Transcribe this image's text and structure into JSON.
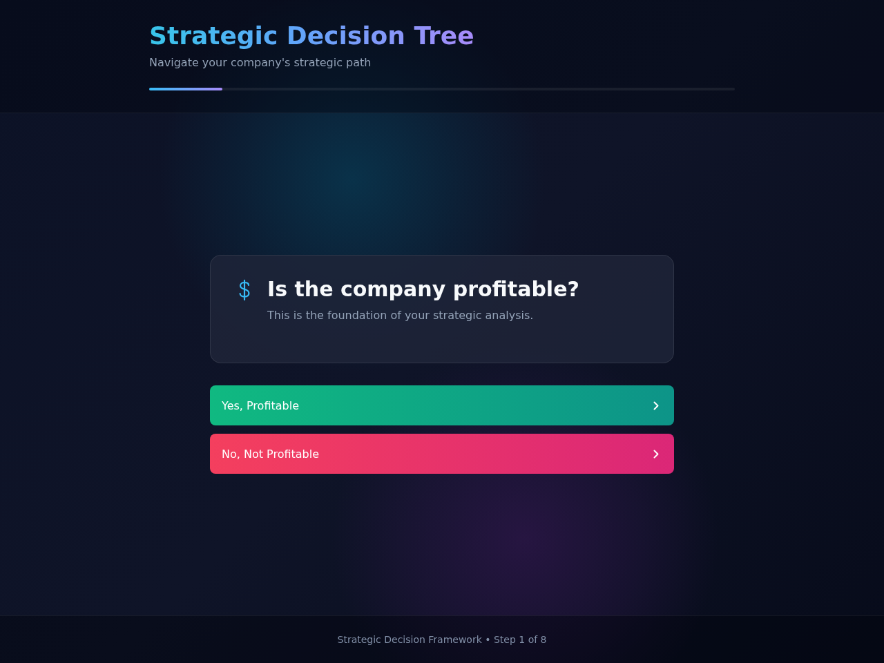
{
  "header": {
    "title": "Strategic Decision Tree",
    "subtitle": "Navigate your company's strategic path",
    "progress": {
      "level": 0.125
    }
  },
  "question": {
    "title": "Is the company profitable?",
    "description": "This is the foundation of your strategic analysis."
  },
  "options": [
    {
      "label": "Yes, Profitable",
      "kind": "positive"
    },
    {
      "label": "No, Not Profitable",
      "kind": "negative"
    }
  ],
  "footer": {
    "text": "Strategic Decision Framework • Step 1 of 8"
  }
}
